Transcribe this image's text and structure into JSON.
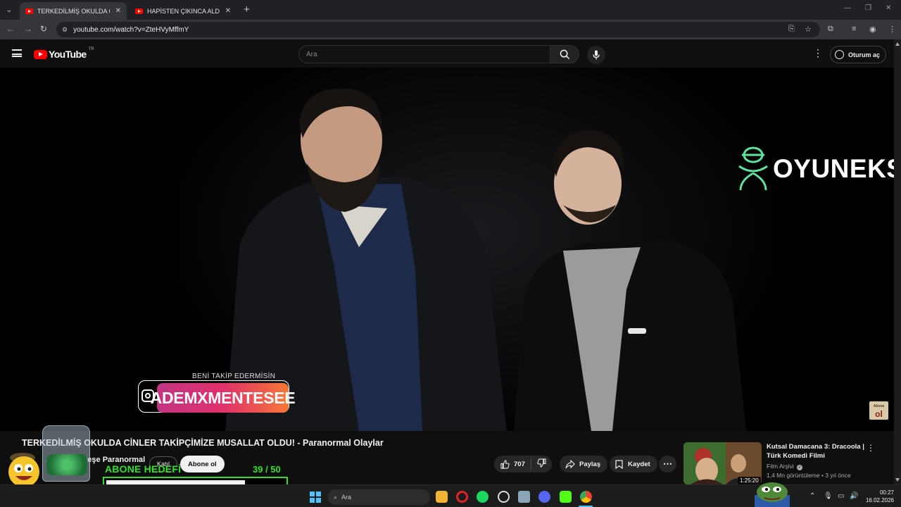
{
  "browser": {
    "tabs": [
      {
        "title": "TERKEDİLMİŞ OKULDA CİNLER TA",
        "active": true
      },
      {
        "title": "HAPİSTEN ÇIKINCA ALDATILDIĞ",
        "active": false
      }
    ],
    "close_glyph": "✕",
    "new_tab_glyph": "+",
    "url": "youtube.com/watch?v=ZteHVyMffmY"
  },
  "youtube": {
    "logo_text": "YouTube",
    "country_code": "TR",
    "search_placeholder": "Ara",
    "signin_label": "Oturum aç"
  },
  "video": {
    "instagram_caption": "BENİ TAKİP EDERMİSİN",
    "instagram_handle": "ADEMXMENTESEE",
    "brand_watermark": "OYUNEKS",
    "subscribe_badge": {
      "small": "Abone",
      "big": "ol"
    },
    "title": "TERKEDİLMİŞ OKULDA CİNLER TAKİPÇİMİZE MUSALLAT OLDU! - Paranormal Olaylar",
    "channel": "Adem Menteşe Paranormal",
    "join_label": "Katıl",
    "subscribe_label": "Abone ol",
    "likes": "707",
    "share_label": "Paylaş",
    "save_label": "Kaydet",
    "more_glyph": "⋯"
  },
  "recommended": [
    {
      "title": "Kutsal Damacana 3: Dracoola | Türk Komedi Filmi",
      "channel": "Film Arşivi",
      "meta": "1,4 Mn görüntüleme • 3 yıl önce",
      "duration": "1:25:20"
    }
  ],
  "overlay": {
    "goal_label": "ABONE HEDEFİ",
    "goal_current": 39,
    "goal_target": 50,
    "goal_count_text": "39  / 50",
    "progress_fraction": 0.78,
    "accent_color": "#32e02c"
  },
  "taskbar": {
    "search_placeholder": "Ara",
    "time": "00:27",
    "date": "16.02.2026"
  },
  "colors": {
    "yt_red": "#ff0000",
    "background": "#0f0f0f",
    "instagram_gradient": [
      "#c13584",
      "#e1306c",
      "#f77737"
    ]
  }
}
